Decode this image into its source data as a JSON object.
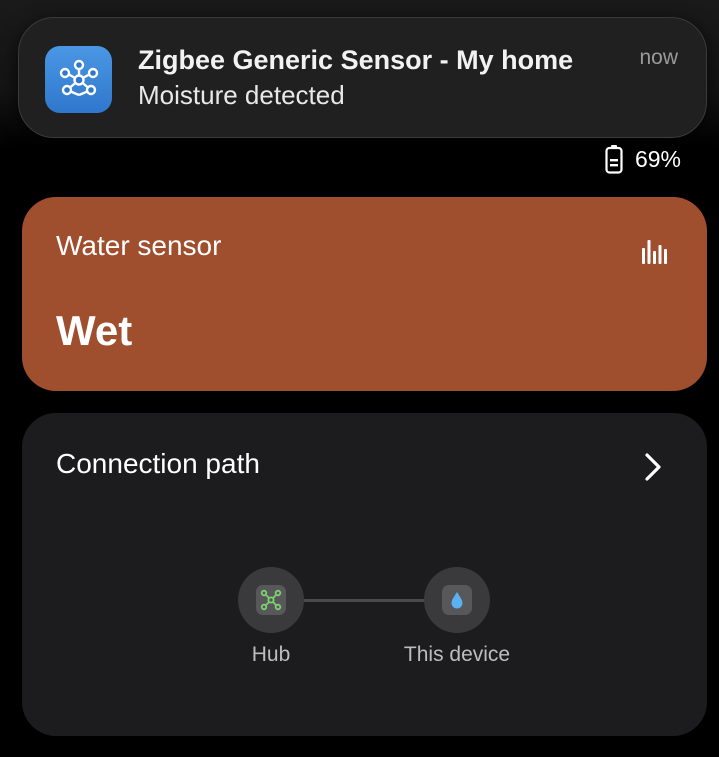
{
  "notification": {
    "icon": "zigbee-hub-icon",
    "title": "Zigbee Generic Sensor - My home",
    "body": "Moisture detected",
    "time": "now"
  },
  "battery": {
    "icon": "battery-icon",
    "level": "69%"
  },
  "water_sensor_card": {
    "label": "Water sensor",
    "status": "Wet",
    "history_icon": "bar-chart-icon",
    "color": "#a04f2e"
  },
  "connection_card": {
    "title": "Connection path",
    "chevron_icon": "chevron-right-icon",
    "nodes": [
      {
        "label": "Hub",
        "icon": "hub-icon"
      },
      {
        "label": "This device",
        "icon": "water-drop-icon"
      }
    ]
  }
}
